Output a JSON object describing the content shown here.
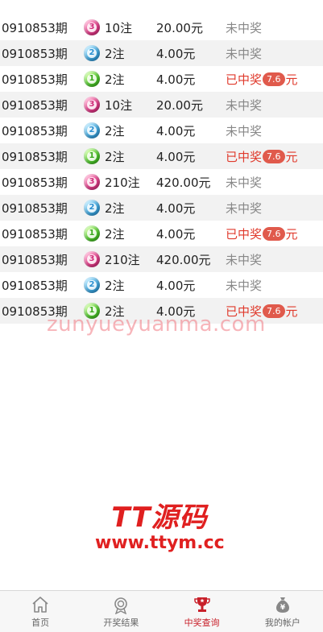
{
  "rows": [
    {
      "period": "0910853期",
      "ball": "3",
      "color": "pink",
      "bets": "10注",
      "amount": "20.00元",
      "status": "未中奖",
      "win": false
    },
    {
      "period": "0910853期",
      "ball": "2",
      "color": "blue",
      "bets": "2注",
      "amount": "4.00元",
      "status": "未中奖",
      "win": false
    },
    {
      "period": "0910853期",
      "ball": "1",
      "color": "green",
      "bets": "2注",
      "amount": "4.00元",
      "status": "已中奖",
      "prize": "7.6",
      "unit": "元",
      "win": true
    },
    {
      "period": "0910853期",
      "ball": "3",
      "color": "pink",
      "bets": "10注",
      "amount": "20.00元",
      "status": "未中奖",
      "win": false
    },
    {
      "period": "0910853期",
      "ball": "2",
      "color": "blue",
      "bets": "2注",
      "amount": "4.00元",
      "status": "未中奖",
      "win": false
    },
    {
      "period": "0910853期",
      "ball": "1",
      "color": "green",
      "bets": "2注",
      "amount": "4.00元",
      "status": "已中奖",
      "prize": "7.6",
      "unit": "元",
      "win": true
    },
    {
      "period": "0910853期",
      "ball": "3",
      "color": "pink",
      "bets": "210注",
      "amount": "420.00元",
      "status": "未中奖",
      "win": false
    },
    {
      "period": "0910853期",
      "ball": "2",
      "color": "blue",
      "bets": "2注",
      "amount": "4.00元",
      "status": "未中奖",
      "win": false
    },
    {
      "period": "0910853期",
      "ball": "1",
      "color": "green",
      "bets": "2注",
      "amount": "4.00元",
      "status": "已中奖",
      "prize": "7.6",
      "unit": "元",
      "win": true
    },
    {
      "period": "0910853期",
      "ball": "3",
      "color": "pink",
      "bets": "210注",
      "amount": "420.00元",
      "status": "未中奖",
      "win": false
    },
    {
      "period": "0910853期",
      "ball": "2",
      "color": "blue",
      "bets": "2注",
      "amount": "4.00元",
      "status": "未中奖",
      "win": false
    },
    {
      "period": "0910853期",
      "ball": "1",
      "color": "green",
      "bets": "2注",
      "amount": "4.00元",
      "status": "已中奖",
      "prize": "7.6",
      "unit": "元",
      "win": true
    }
  ],
  "watermark": "zunyueyuanma.com",
  "logo": {
    "title": "TT源码",
    "url": "www.ttym.cc"
  },
  "tabs": [
    {
      "label": "首页",
      "icon": "home-icon",
      "active": false
    },
    {
      "label": "开奖结果",
      "icon": "medal-icon",
      "active": false
    },
    {
      "label": "中奖查询",
      "icon": "trophy-icon",
      "active": true
    },
    {
      "label": "我的帐户",
      "icon": "money-bag-icon",
      "active": false
    }
  ],
  "colors": {
    "accent": "#c8202a",
    "win": "#e03a2c",
    "lose": "#888888",
    "badge": "#e05a4c"
  }
}
